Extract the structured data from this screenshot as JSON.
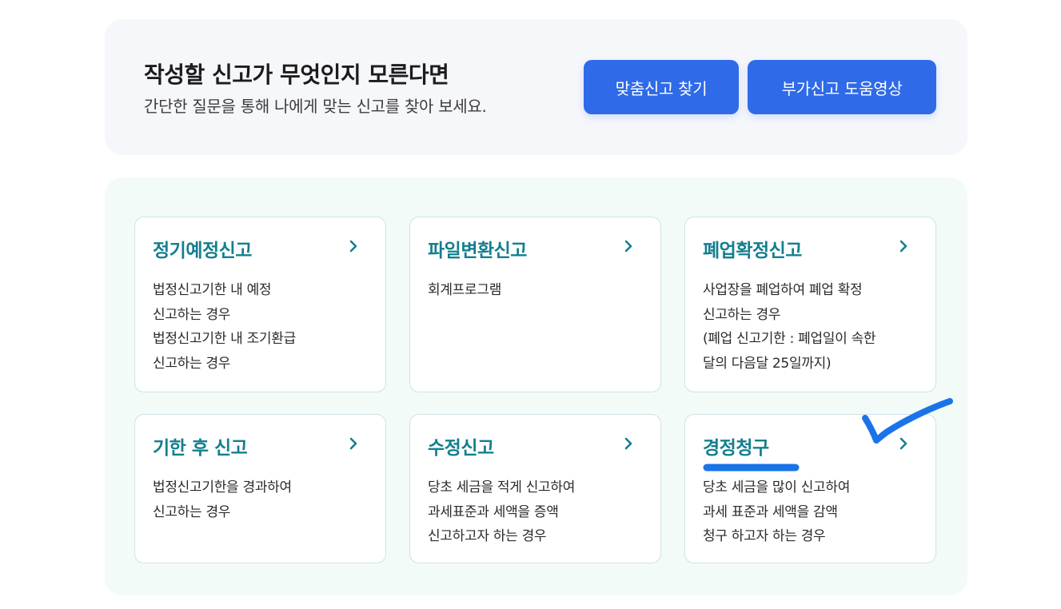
{
  "banner": {
    "title": "작성할 신고가 무엇인지 모른다면",
    "subtitle": "간단한 질문을 통해 나에게 맞는 신고를 찾아 보세요.",
    "buttons": {
      "find_label": "맞춤신고 찾기",
      "video_label": "부가신고 도움영상"
    }
  },
  "cards": [
    {
      "title": "정기예정신고",
      "lines": [
        "법정신고기한 내 예정",
        "신고하는 경우",
        "법정신고기한 내 조기환급",
        "신고하는 경우"
      ]
    },
    {
      "title": "파일변환신고",
      "lines": [
        "회계프로그램"
      ]
    },
    {
      "title": "폐업확정신고",
      "lines": [
        "사업장을 폐업하여 폐업 확정",
        "신고하는 경우",
        "(폐업 신고기한 : 폐업일이 속한",
        "달의 다음달 25일까지)"
      ]
    },
    {
      "title": "기한 후 신고",
      "lines": [
        "법정신고기한을 경과하여",
        "신고하는 경우"
      ]
    },
    {
      "title": "수정신고",
      "lines": [
        "당초 세금을 적게 신고하여",
        "과세표준과 세액을 증액",
        "신고하고자 하는 경우"
      ]
    },
    {
      "title": "경정청구",
      "lines": [
        "당초 세금을 많이 신고하여",
        "과세 표준과 세액을 감액",
        "청구 하고자 하는 경우"
      ]
    }
  ],
  "icons": {
    "card_arrow": "chevron-right-icon",
    "annotation": "checkmark-annotation"
  },
  "colors": {
    "accent_blue": "#2f6ae8",
    "title_teal": "#137f8f",
    "annotation_blue": "#1a73e8"
  }
}
